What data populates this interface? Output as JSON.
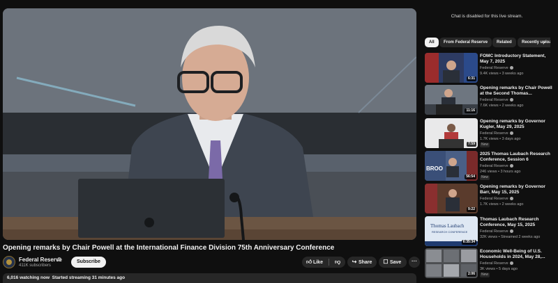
{
  "video": {
    "title": "Opening remarks by Chair Powell at the International Finance Division 75th Anniversary Conference"
  },
  "channel": {
    "name": "Federal Reserve",
    "subscribers": "411K subscribers",
    "subscribe_label": "Subscribe"
  },
  "actions": {
    "like_label": "Like",
    "share_label": "Share",
    "save_label": "Save",
    "more_glyph": "···"
  },
  "description": {
    "watching": "6,016 watching now",
    "started": "Started streaming 31 minutes ago"
  },
  "sidebar": {
    "chat_disabled": "Chat is disabled for this live stream.",
    "chips": [
      "All",
      "From Federal Reserve",
      "Related",
      "Recently uploaded"
    ],
    "chip_arrow": "›",
    "recommendations": [
      {
        "title": "FOMC Introductory Statement, May 7, 2025",
        "channel": "Federal Reserve",
        "meta": "9.4K views • 3 weeks ago",
        "duration": "6:31",
        "badge": ""
      },
      {
        "title": "Opening remarks by Chair Powell at the Second Thomas...",
        "channel": "Federal Reserve",
        "meta": "7.6K views • 2 weeks ago",
        "duration": "11:16",
        "badge": ""
      },
      {
        "title": "Opening remarks by Governor Kugler, May 29, 2025",
        "channel": "Federal Reserve",
        "meta": "1.7K views • 3 days ago",
        "duration": "7:59",
        "badge": "New"
      },
      {
        "title": "2025 Thomas Laubach Research Conference, Session 6",
        "channel": "Federal Reserve",
        "meta": "246 views • 3 hours ago",
        "duration": "56:54",
        "badge": "New"
      },
      {
        "title": "Opening remarks by Governor Barr, May 15, 2025",
        "channel": "Federal Reserve",
        "meta": "1.7K views • 2 weeks ago",
        "duration": "9:22",
        "badge": ""
      },
      {
        "title": "Thomas Laubach Research Conference, May 15, 2025",
        "channel": "Federal Reserve",
        "meta": "32K views • Streamed 2 weeks ago",
        "duration": "6:35:34",
        "badge": ""
      },
      {
        "title": "Economic Well-Being of U.S. Households in 2024, May 28,...",
        "channel": "Federal Reserve",
        "meta": "3K views • 5 days ago",
        "duration": "2:06",
        "badge": "New"
      }
    ]
  },
  "colors": {
    "background": "#0f0f0f",
    "surface": "#272727",
    "text": "#f1f1f1",
    "muted_text": "#aaaaaa"
  },
  "icons": [
    "verified-icon",
    "like-icon",
    "dislike-icon",
    "share-icon",
    "save-icon",
    "more-icon",
    "chevron-right-icon"
  ]
}
